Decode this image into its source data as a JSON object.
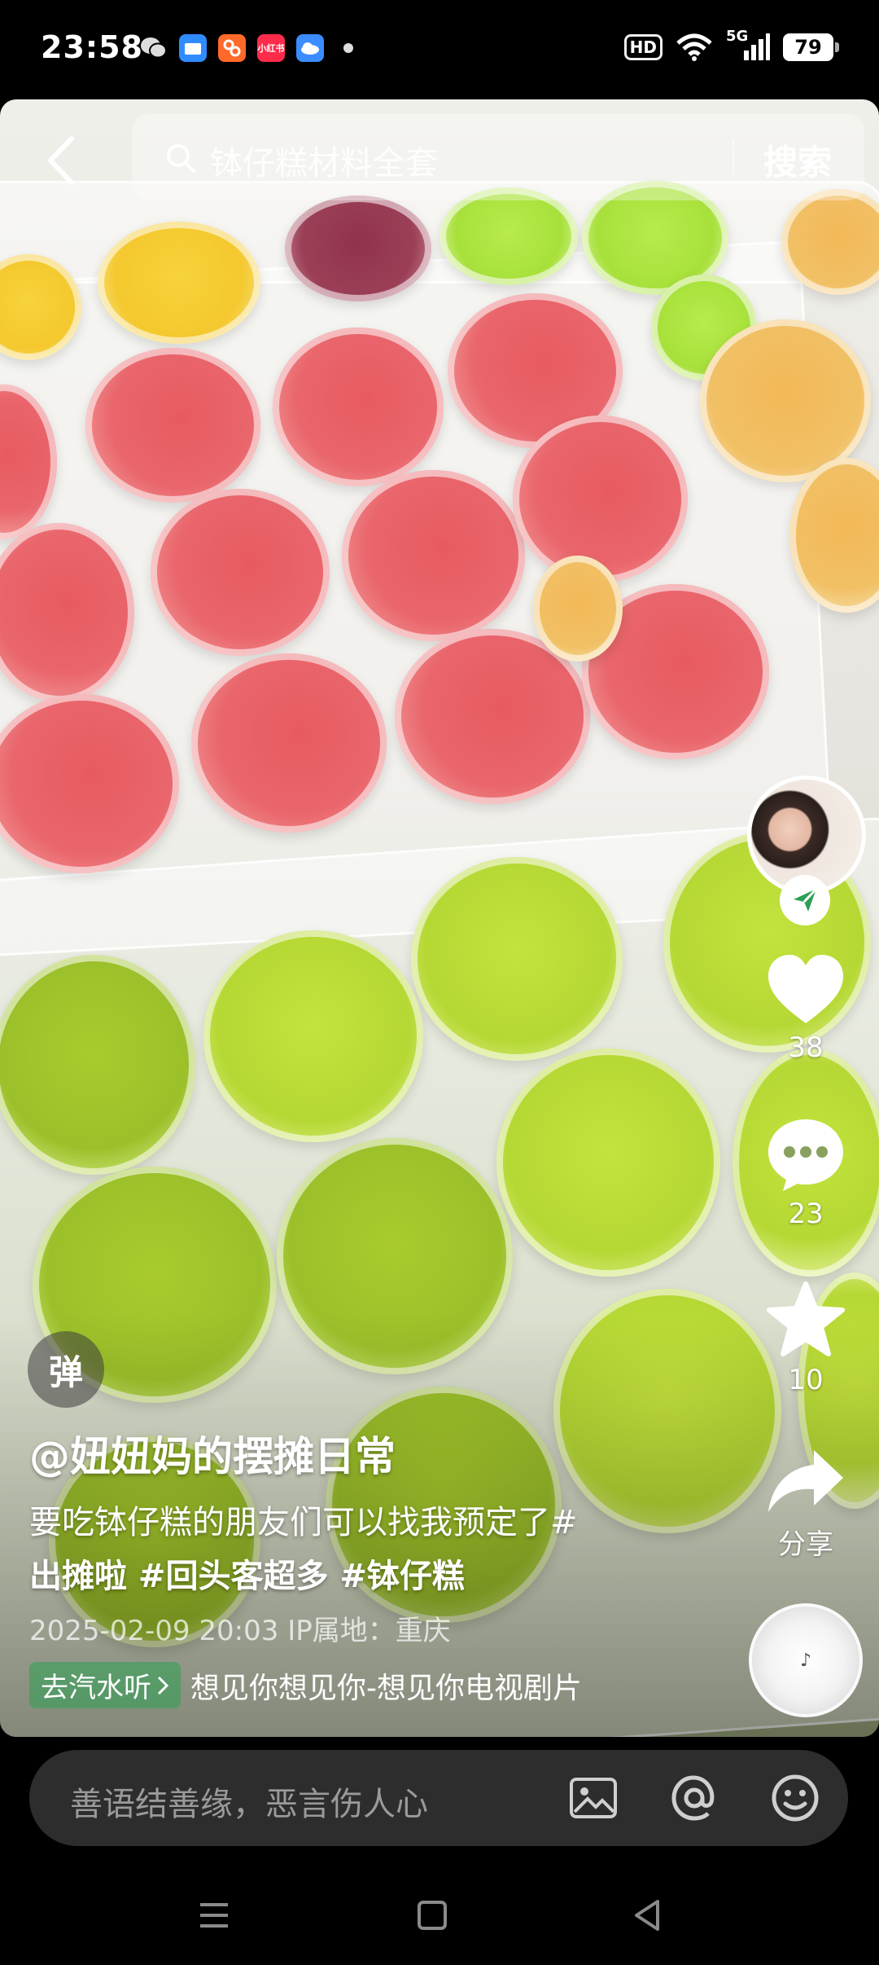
{
  "status_bar": {
    "time": "23:58",
    "app_icons": [
      {
        "name": "wechat-icon",
        "color": "#d9d9d9"
      },
      {
        "name": "files-icon",
        "color": "#2f8cff"
      },
      {
        "name": "video-app-icon",
        "color": "#ff6a2b"
      },
      {
        "name": "xiaohongshu-icon",
        "color": "#ff2b4a"
      },
      {
        "name": "weather-icon",
        "color": "#3b8cff"
      }
    ],
    "hd_label": "HD",
    "network": "5G",
    "battery": "79"
  },
  "top_bar": {
    "search_query": "钵仔糕材料全套",
    "search_button": "搜索"
  },
  "actions": {
    "likes": "38",
    "comments": "23",
    "favorites": "10",
    "share_label": "分享"
  },
  "post": {
    "danmu_label": "弹",
    "author": "@妞妞妈的摆摊日常",
    "description": "要吃钵仔糕的朋友们可以找我预定了#",
    "tags": "出摊啦 #回头客超多 #钵仔糕",
    "meta": "2025-02-09 20:03  IP属地：重庆",
    "music_chip": "去汽水听",
    "music_title": "想见你想见你-想见你电视剧片"
  },
  "comment_bar": {
    "placeholder": "善语结善缘，恶言伤人心"
  },
  "colors": {
    "accent_green": "#2ea054",
    "comment_bar_bg": "#2d2d2d"
  }
}
